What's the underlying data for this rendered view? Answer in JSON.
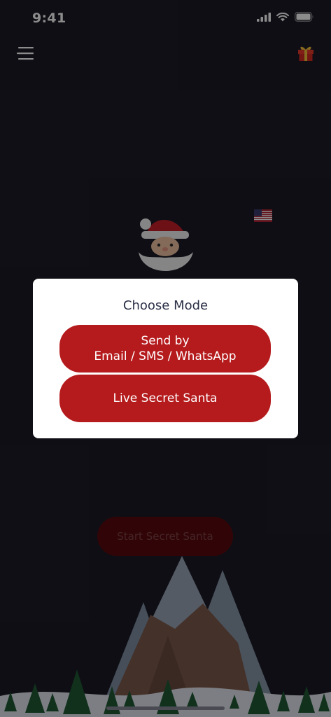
{
  "status_bar": {
    "time": "9:41"
  },
  "header": {
    "menu_icon": "hamburger-menu-icon",
    "gift_icon": "gift-icon"
  },
  "home": {
    "start_button_label": "Start Secret Santa",
    "flag_icon": "us-flag-icon",
    "mascot": "santa-claus-illustration"
  },
  "modal": {
    "title": "Choose Mode",
    "send_line1": "Send by",
    "send_line2": "Email / SMS / WhatsApp",
    "live_label": "Live Secret Santa"
  },
  "colors": {
    "background": "#1b1b26",
    "accent_red": "#b51a1c",
    "modal_bg": "#ffffff",
    "title_text": "#2a2f45"
  }
}
